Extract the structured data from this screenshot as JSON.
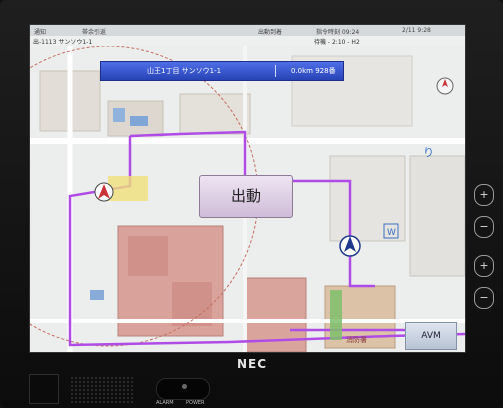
{
  "status_bar": {
    "left": "通知",
    "mid": "帯余引返",
    "right1": "出動到着",
    "right2": "指令時刻 09:24",
    "date": "2/11 9:28"
  },
  "sub_bar": {
    "left": "出-1113 サンソウ1-1",
    "mid": "待機 - 2:10 - H2"
  },
  "banner": {
    "location": "山王1丁目 サンソウ1-1",
    "distance": "0.0km 928番"
  },
  "dispatch_button": {
    "label": "出動"
  },
  "avm_button": {
    "label": "AVM"
  },
  "side_controls": {
    "zoom_in": "+",
    "zoom_out": "−",
    "scroll_up": "+",
    "scroll_down": "−"
  },
  "brand": {
    "name": "NEC"
  },
  "bottom": {
    "alarm_label": "ALARM",
    "power_label": "POWER"
  },
  "map_labels": {
    "poi_1": "W",
    "text_1": "消防署"
  },
  "colors": {
    "route": "#b04ce6",
    "banner": "#3555d1",
    "marker": "#1f3a8a"
  },
  "icons": [
    "compass-icon",
    "vehicle-marker-icon",
    "target-marker-icon"
  ]
}
